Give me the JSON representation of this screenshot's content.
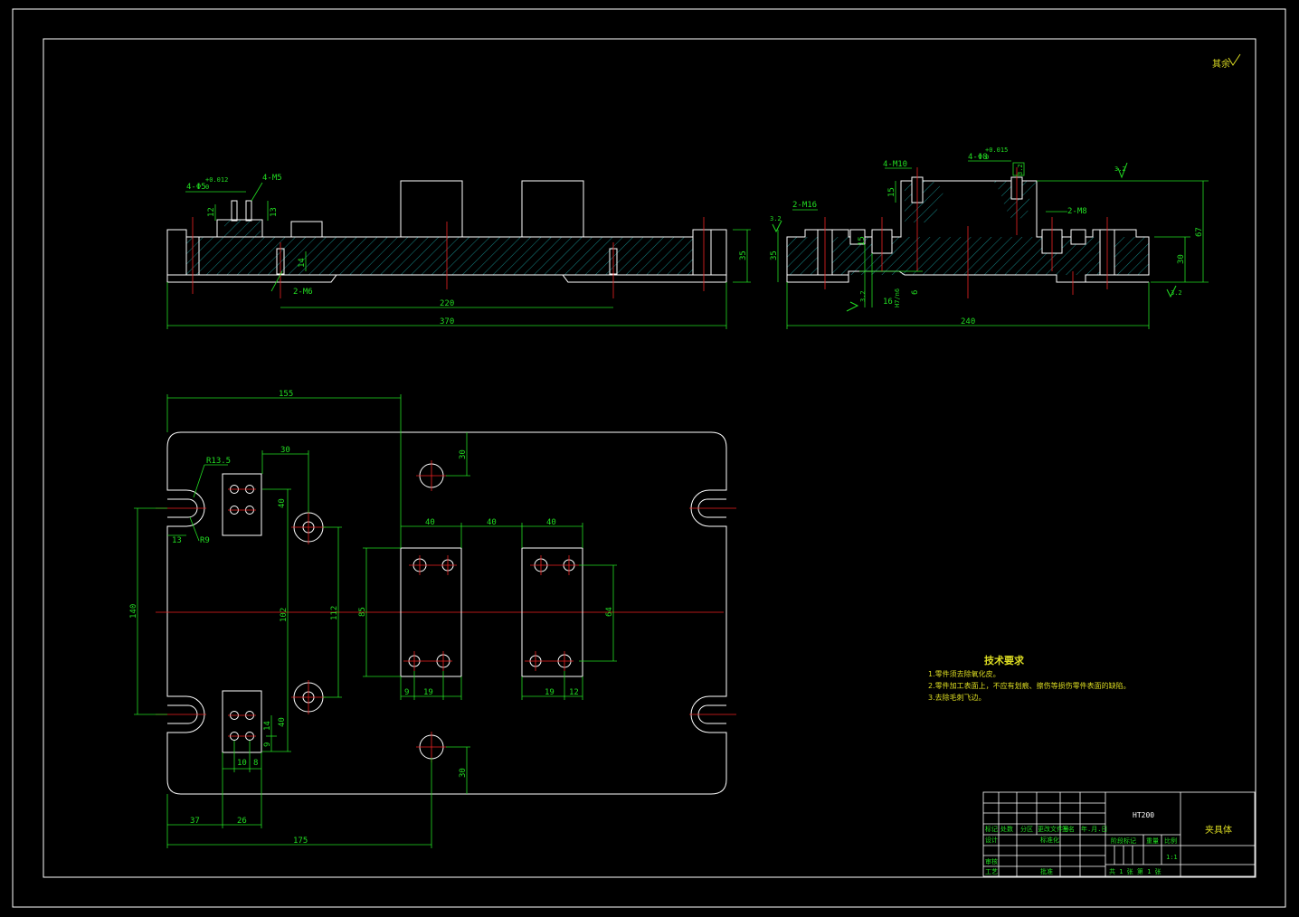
{
  "corner_note": "其余",
  "side_view": {
    "left_top_labels": {
      "hole": "4-Φ5",
      "hole_tol_up": "+0.012",
      "hole_tol_dn": "0",
      "thread": "4-M5",
      "dim12": "12",
      "dim13": "13"
    },
    "bottom_thread": "2-M6",
    "dim14": "14",
    "dim_height": "35",
    "dim220": "220",
    "dim370": "370"
  },
  "front_view": {
    "m10": "4-M10",
    "pin": "4-Φ8",
    "pin_tol_up": "+0.015",
    "pin_tol_dn": "0",
    "m16": "2-M16",
    "m8": "2-M8",
    "dim15": "15",
    "dim35": "35",
    "dim30": "30",
    "dim67": "67",
    "dim240": "240",
    "dim6": "6",
    "dim15b": "15",
    "dim16": "16",
    "roughness_32": "3.2",
    "fit": "H7/n6"
  },
  "top_view": {
    "dim155": "155",
    "dim30a": "30",
    "dim30b": "30",
    "dim30c": "30",
    "r135": "R13.5",
    "r9": "R9",
    "dim13": "13",
    "dim40a": "40",
    "dim40b": "40",
    "dim40c": "40",
    "dim40d": "40",
    "dim40e": "40",
    "dim40f": "40",
    "dim140": "140",
    "dim102": "102",
    "dim112": "112",
    "dim85": "85",
    "dim64": "64",
    "dim9": "9",
    "dim19a": "19",
    "dim19b": "19",
    "dim12": "12",
    "dim14": "14",
    "dim9b": "9",
    "dim10": "10",
    "dim8": "8",
    "dim37": "37",
    "dim26": "26",
    "dim175": "175"
  },
  "tech_req": {
    "title": "技术要求",
    "lines": [
      "1.零件须去除氧化皮。",
      "2.零件加工表面上，不应有划痕、擦伤等损伤零件表面的缺陷。",
      "3.去除毛刺飞边。"
    ]
  },
  "title_block": {
    "material": "HT200",
    "part_name": "夹具体",
    "row_labels": [
      "标记",
      "处数",
      "分区",
      "更改文件号",
      "签名",
      "年.月.日"
    ],
    "design": "设计",
    "standard": "标准化",
    "check": "审核",
    "process": "工艺",
    "approve": "批准",
    "stage_mark": "阶段标记",
    "weight": "重量",
    "scale_label": "比例",
    "scale": "1:1",
    "sheets": "共 1 张    第 1 张"
  }
}
